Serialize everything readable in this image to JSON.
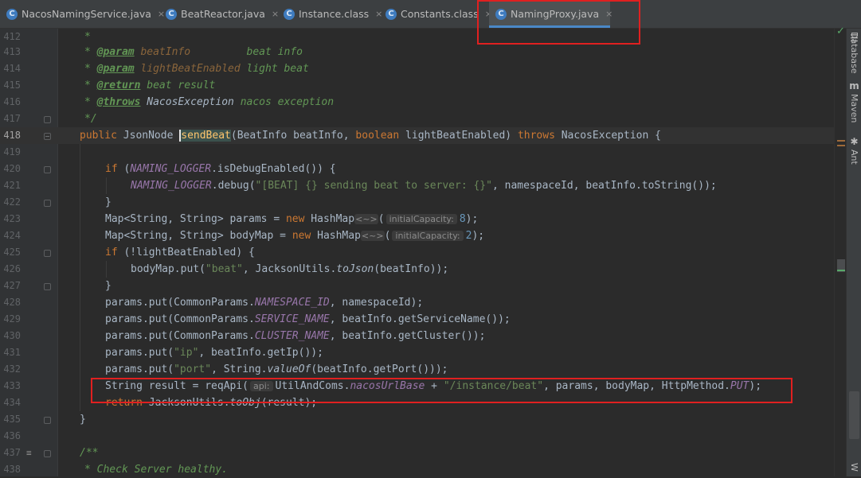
{
  "tabs": [
    {
      "label": "NacosNamingService.java",
      "icon": "C",
      "active": false
    },
    {
      "label": "BeatReactor.java",
      "icon": "C",
      "active": false
    },
    {
      "label": "Instance.class",
      "icon": "C",
      "active": false
    },
    {
      "label": "Constants.class",
      "icon": "C",
      "active": false
    },
    {
      "label": "NamingProxy.java",
      "icon": "C",
      "active": true
    }
  ],
  "close_glyph": "×",
  "right_tools": {
    "database": "Database",
    "maven": "Maven",
    "ant": "Ant",
    "extra": "W"
  },
  "status": {
    "inspection_ok": "✓"
  },
  "code": {
    "current_line": "418",
    "lines": [
      {
        "n": "412",
        "t": "doc_star"
      },
      {
        "n": "413",
        "tag": "@param",
        "name": "beatInfo",
        "desc": "beat info"
      },
      {
        "n": "414",
        "tag": "@param",
        "name": "lightBeatEnabled",
        "desc": "light beat"
      },
      {
        "n": "415",
        "tag": "@return",
        "desc": "beat result"
      },
      {
        "n": "416",
        "tag": "@throws",
        "type": "NacosException",
        "desc": "nacos exception"
      },
      {
        "n": "417",
        "text": "*/"
      },
      {
        "n": "418",
        "kw_public": "public",
        "type_ret": "JsonNode",
        "method": "sendBeat",
        "param1": "(BeatInfo beatInfo, ",
        "kw_boolean": "boolean",
        "param2": " lightBeatEnabled) ",
        "kw_throws": "throws",
        "exc": " NacosException {"
      },
      {
        "n": "419"
      },
      {
        "n": "420",
        "kw_if": "if",
        "p1": " (",
        "const": "NAMING_LOGGER",
        "p2": ".isDebugEnabled()) {"
      },
      {
        "n": "421",
        "const": "NAMING_LOGGER",
        "p1": ".debug(",
        "str": "\"[BEAT] {} sending beat to server: {}\"",
        "p2": ", namespaceId, beatInfo.toString());"
      },
      {
        "n": "422",
        "text": "}"
      },
      {
        "n": "423",
        "p1": "Map<String, String> params = ",
        "kw_new": "new",
        "p2": " HashMap",
        "diamond": "<~>",
        "p3": "(",
        "hint": "initialCapacity:",
        "num": "8",
        "p4": ");"
      },
      {
        "n": "424",
        "p1": "Map<String, String> bodyMap = ",
        "kw_new": "new",
        "p2": " HashMap",
        "diamond": "<~>",
        "p3": "(",
        "hint": "initialCapacity:",
        "num": "2",
        "p4": ");"
      },
      {
        "n": "425",
        "kw_if": "if",
        "p1": " (!lightBeatEnabled) {"
      },
      {
        "n": "426",
        "p1": "bodyMap.put(",
        "str": "\"beat\"",
        "p2": ", JacksonUtils.",
        "ital": "toJson",
        "p3": "(beatInfo));"
      },
      {
        "n": "427",
        "text": "}"
      },
      {
        "n": "428",
        "p1": "params.put(CommonParams.",
        "const": "NAMESPACE_ID",
        "p2": ", namespaceId);"
      },
      {
        "n": "429",
        "p1": "params.put(CommonParams.",
        "const": "SERVICE_NAME",
        "p2": ", beatInfo.getServiceName());"
      },
      {
        "n": "430",
        "p1": "params.put(CommonParams.",
        "const": "CLUSTER_NAME",
        "p2": ", beatInfo.getCluster());"
      },
      {
        "n": "431",
        "p1": "params.put(",
        "str": "\"ip\"",
        "p2": ", beatInfo.getIp());"
      },
      {
        "n": "432",
        "p1": "params.put(",
        "str": "\"port\"",
        "p2": ", String.",
        "ital": "valueOf",
        "p3": "(beatInfo.getPort()));"
      },
      {
        "n": "433",
        "p1": "String result = reqApi(",
        "hint": "api:",
        "p2": "UtilAndComs.",
        "const": "nacosUrlBase",
        "p3": " + ",
        "str": "\"/instance/beat\"",
        "p4": ", params, bodyMap, HttpMethod.",
        "const2": "PUT",
        "p5": ");"
      },
      {
        "n": "434",
        "kw_return": "return",
        "p1": " JacksonUtils.",
        "ital": "toObj",
        "p2": "(result);"
      },
      {
        "n": "435",
        "text": "}"
      },
      {
        "n": "436"
      },
      {
        "n": "437",
        "text": "/**"
      },
      {
        "n": "438",
        "text": "* Check Server healthy."
      }
    ]
  }
}
